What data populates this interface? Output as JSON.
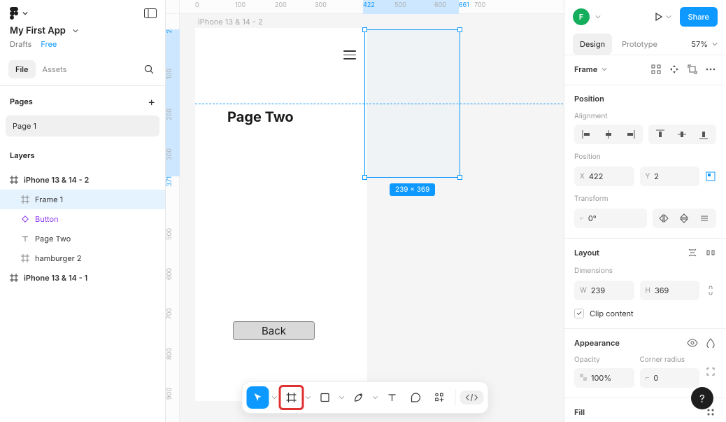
{
  "header": {
    "project_name": "My First App",
    "location": "Drafts",
    "plan": "Free"
  },
  "file_tabs": {
    "file": "File",
    "assets": "Assets"
  },
  "pages": {
    "heading": "Pages",
    "page1": "Page 1"
  },
  "layers": {
    "heading": "Layers",
    "items": [
      {
        "label": "iPhone 13 & 14 - 2"
      },
      {
        "label": "Frame 1"
      },
      {
        "label": "Button"
      },
      {
        "label": "Page Two"
      },
      {
        "label": "hamburger 2"
      },
      {
        "label": "iPhone 13 & 14 - 1"
      }
    ]
  },
  "canvas": {
    "frame_label": "iPhone 13 & 14 - 2",
    "page_two_text": "Page Two",
    "back_label": "Back",
    "selection_dim": "239 × 369",
    "ruler_h": {
      "t0": "0",
      "t100": "100",
      "t200": "200",
      "t300": "300",
      "t422": "422",
      "t500": "500",
      "t600": "600",
      "t661": "661",
      "t700": "700"
    },
    "ruler_v": {
      "t100": "100",
      "t2": "2",
      "t200": "200",
      "t300": "300",
      "t371": "371",
      "t500": "500",
      "t600": "600",
      "t700": "700",
      "t800": "800",
      "t900": "900"
    }
  },
  "right": {
    "avatar": "F",
    "share": "Share",
    "tabs": {
      "design": "Design",
      "prototype": "Prototype"
    },
    "zoom": "57%",
    "frame_label": "Frame",
    "position": {
      "heading": "Position",
      "alignment": "Alignment",
      "position_label": "Position",
      "x_label": "X",
      "x_val": "422",
      "y_label": "Y",
      "y_val": "2",
      "transform": "Transform",
      "rot": "0°"
    },
    "layout": {
      "heading": "Layout",
      "dimensions": "Dimensions",
      "w_label": "W",
      "w_val": "239",
      "h_label": "H",
      "h_val": "369",
      "clip": "Clip content"
    },
    "appearance": {
      "heading": "Appearance",
      "opacity_label": "Opacity",
      "opacity_val": "100%",
      "corner_label": "Corner radius",
      "corner_val": "0"
    },
    "fill": {
      "heading": "Fill"
    }
  }
}
